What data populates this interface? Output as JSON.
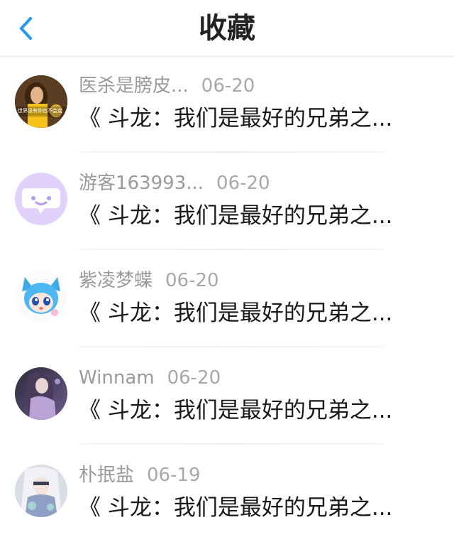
{
  "header": {
    "title": "收藏",
    "back_icon": "chevron-left-icon",
    "accent": "#2196f3"
  },
  "items": [
    {
      "name": "医杀是膀皮...",
      "date": "06-20",
      "title": "《 斗龙：我们是最好的兄弟之...",
      "avatar_caption": "世界没有你也不会变",
      "avatar_type": "photo"
    },
    {
      "name": "游客163993...",
      "date": "06-20",
      "title": "《 斗龙：我们是最好的兄弟之...",
      "avatar_type": "default-chat-icon"
    },
    {
      "name": "紫凌梦蝶",
      "date": "06-20",
      "title": "《 斗龙：我们是最好的兄弟之...",
      "avatar_type": "anime-blue-cat"
    },
    {
      "name": "Winnam",
      "date": "06-20",
      "title": "《 斗龙：我们是最好的兄弟之...",
      "avatar_type": "anime-purple"
    },
    {
      "name": "朴抿盐",
      "date": "06-19",
      "title": "《 斗龙：我们是最好的兄弟之...",
      "avatar_type": "anime-white-hair"
    }
  ]
}
